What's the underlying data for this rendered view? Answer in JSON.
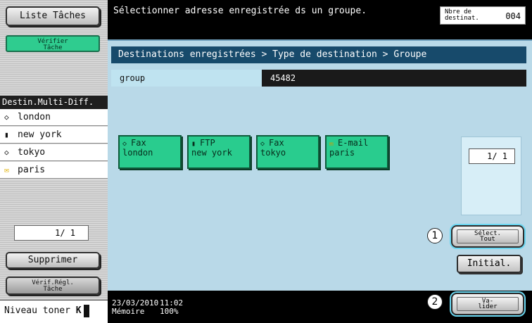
{
  "left": {
    "job_list_label": "Liste Tâches",
    "check_job_label": "Vérifier Tâche",
    "multi_header": "Destin.Multi-Diff.",
    "multi_items": [
      {
        "icon": "fax-icon",
        "glyph": "◇",
        "name": "london"
      },
      {
        "icon": "ftp-icon",
        "glyph": "▮",
        "name": "new york"
      },
      {
        "icon": "fax-icon",
        "glyph": "◇",
        "name": "tokyo"
      },
      {
        "icon": "email-icon",
        "glyph": "✉",
        "name": "paris"
      }
    ],
    "page_indicator": "1/ 1",
    "delete_label": "Supprimer",
    "check_settings_label": "Vérif.Régl. Tâche",
    "toner_label": "Niveau toner",
    "toner_letter": "K"
  },
  "main": {
    "message": "Sélectionner adresse enregistrée ds un groupe.",
    "dest_count_label": "Nbre de destinat.",
    "dest_count_value": "004",
    "breadcrumb": "Destinations enregistrées > Type de destination > Groupe",
    "group_label": "group",
    "group_value": "45482",
    "tiles": [
      {
        "type": "Fax",
        "glyph": "◇",
        "icon": "fax-icon",
        "name": "london"
      },
      {
        "type": "FTP",
        "glyph": "▮",
        "icon": "ftp-icon",
        "name": "new york"
      },
      {
        "type": "Fax",
        "glyph": "◇",
        "icon": "fax-icon",
        "name": "tokyo"
      },
      {
        "type": "E-mail",
        "glyph": "✉",
        "icon": "email-icon",
        "name": "paris"
      }
    ],
    "page_indicator": "1/ 1",
    "select_all_label": "Sélect. Tout",
    "initial_label": "Initial.",
    "validate_label": "Va- lider",
    "callout_1": "1",
    "callout_2": "2"
  },
  "status": {
    "date": "23/03/2010",
    "time": "11:02",
    "memory_label": "Mémoire",
    "memory_value": "100%"
  },
  "colors": {
    "accent_green": "#29cc8e",
    "panel_blue": "#b9d9e8",
    "breadcrumb_blue": "#174a6b",
    "email_yellow": "#ffd21a"
  }
}
